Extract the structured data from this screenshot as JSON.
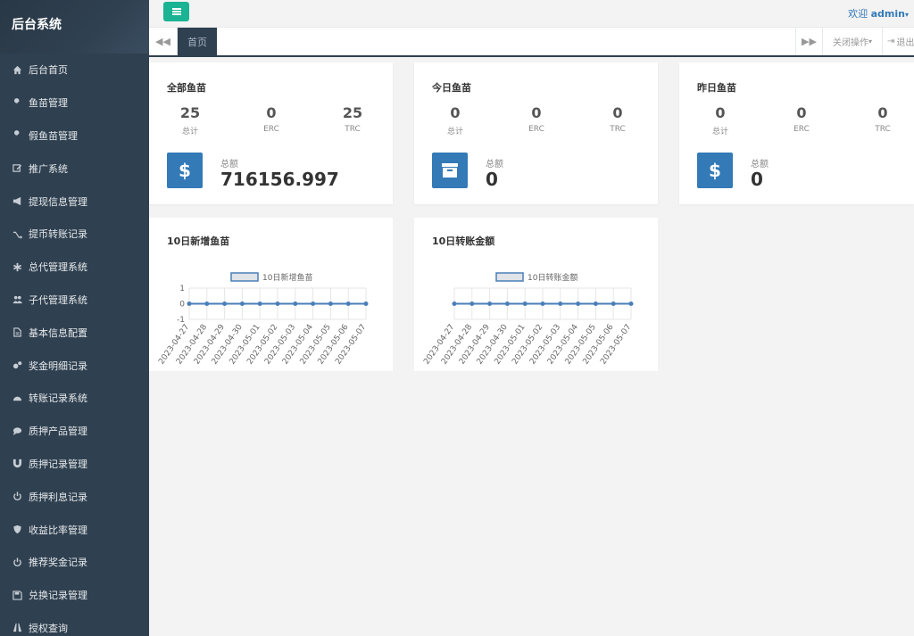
{
  "sidebar": {
    "brand": "后台系统",
    "items": [
      {
        "label": "后台首页",
        "icon": "home-icon"
      },
      {
        "label": "鱼苗管理",
        "icon": "wrench-icon"
      },
      {
        "label": "假鱼苗管理",
        "icon": "wrench-icon"
      },
      {
        "label": "推广系统",
        "icon": "edit-icon"
      },
      {
        "label": "提现信息管理",
        "icon": "bullhorn-icon"
      },
      {
        "label": "提币转账记录",
        "icon": "random-icon"
      },
      {
        "label": "总代管理系统",
        "icon": "asterisk-icon"
      },
      {
        "label": "子代管理系统",
        "icon": "users-icon"
      },
      {
        "label": "基本信息配置",
        "icon": "file-icon"
      },
      {
        "label": "奖金明细记录",
        "icon": "cogs-icon"
      },
      {
        "label": "转账记录系统",
        "icon": "dashboard-icon"
      },
      {
        "label": "质押产品管理",
        "icon": "comment-icon"
      },
      {
        "label": "质押记录管理",
        "icon": "magnet-icon"
      },
      {
        "label": "质押利息记录",
        "icon": "power-icon"
      },
      {
        "label": "收益比率管理",
        "icon": "shield-icon"
      },
      {
        "label": "推荐奖金记录",
        "icon": "power-icon"
      },
      {
        "label": "兑换记录管理",
        "icon": "save-icon"
      },
      {
        "label": "授权查询",
        "icon": "road-icon"
      }
    ]
  },
  "topbar": {
    "welcome_prefix": "欢迎",
    "username": "admin",
    "toggle_icon": "menu-icon"
  },
  "tabs": {
    "home": "首页",
    "close_ops": "关闭操作",
    "exit": "退出"
  },
  "cards": [
    {
      "title": "全部鱼苗",
      "total": "25",
      "erc": "0",
      "trc": "25",
      "total_label": "总计",
      "erc_label": "ERC",
      "trc_label": "TRC",
      "amount_label": "总额",
      "amount": "716156.997",
      "icon": "dollar-icon"
    },
    {
      "title": "今日鱼苗",
      "total": "0",
      "erc": "0",
      "trc": "0",
      "total_label": "总计",
      "erc_label": "ERC",
      "trc_label": "TRC",
      "amount_label": "总额",
      "amount": "0",
      "icon": "archive-icon"
    },
    {
      "title": "昨日鱼苗",
      "total": "0",
      "erc": "0",
      "trc": "0",
      "total_label": "总计",
      "erc_label": "ERC",
      "trc_label": "TRC",
      "amount_label": "总额",
      "amount": "0",
      "icon": "dollar-icon"
    }
  ],
  "chart_data": [
    {
      "type": "line",
      "title": "10日新增鱼苗",
      "categories": [
        "2023-04-27",
        "2023-04-28",
        "2023-04-29",
        "2023-04-30",
        "2023-05-01",
        "2023-05-02",
        "2023-05-03",
        "2023-05-04",
        "2023-05-05",
        "2023-05-06",
        "2023-05-07"
      ],
      "series": [
        {
          "name": "10日新增鱼苗",
          "values": [
            0,
            0,
            0,
            0,
            0,
            0,
            0,
            0,
            0,
            0,
            0
          ]
        }
      ],
      "yticks": [
        "1",
        "0",
        "-1"
      ],
      "ylim": [
        -1,
        1
      ],
      "legend": "top-center",
      "color": "#4a7fb8"
    },
    {
      "type": "line",
      "title": "10日转账金额",
      "categories": [
        "2023-04-27",
        "2023-04-28",
        "2023-04-29",
        "2023-04-30",
        "2023-05-01",
        "2023-05-02",
        "2023-05-03",
        "2023-05-04",
        "2023-05-05",
        "2023-05-06",
        "2023-05-07"
      ],
      "series": [
        {
          "name": "10日转账金额",
          "values": [
            0,
            0,
            0,
            0,
            0,
            0,
            0,
            0,
            0,
            0,
            0
          ]
        }
      ],
      "yticks": [],
      "ylim": [
        -1,
        1
      ],
      "legend": "top-center",
      "color": "#4a7fb8"
    }
  ]
}
